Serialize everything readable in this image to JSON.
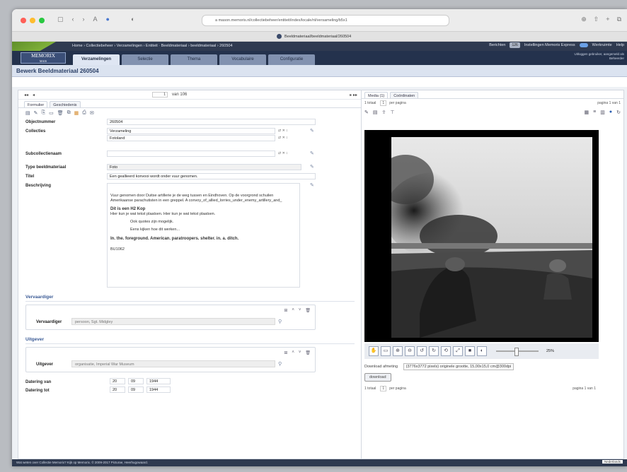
{
  "browser": {
    "url": "a mason.memoris.nl/collectiebeheer/entiteit/index/locale/nl/versameling/b5x1",
    "tab_title": "Beeldmateriaal/beeldmateriaal/260504",
    "colors": {
      "close": "#ff5f57",
      "min": "#febc2e",
      "max": "#28c840"
    }
  },
  "topnav": {
    "breadcrumb": "Home › Collectiebeheer › Verzamelingen › Entiteit · Beeldmateriaal › beeldmateriaal › 260504",
    "berichten_label": "Berichten",
    "berichten_count": "126",
    "instellingen": "Instellingen Memoris Express",
    "werkruimte": "Werkruimte",
    "help": "Help"
  },
  "menubar": {
    "logo": "MEMORIX",
    "logo_sub": "MAIS",
    "tabs": [
      "Verzamelingen",
      "Selectie",
      "Thema",
      "Vocabulaire",
      "Configuratie"
    ],
    "userinfo_1": "Uitloggen gebruiker, aangemeld als",
    "userinfo_2": "Beheerder"
  },
  "page": {
    "title": "Bewerk Beeldmateriaal 260504"
  },
  "pager": {
    "current": "1",
    "total_label": "van 106"
  },
  "subtabs": [
    "Formulier",
    "Geschiedenis"
  ],
  "form": {
    "objectnummer_label": "Objectnummer",
    "objectnummer": "260504",
    "collecties_label": "Collecties",
    "collecties": [
      "Verzameling",
      "Fotoland"
    ],
    "subcollectienaam_label": "Subcollectienaam",
    "subcollectienaam": "",
    "type_label": "Type beeldmateriaal",
    "type_value": "Foto",
    "titel_label": "Titel",
    "titel": "Een geallieerd konvooi wordt onder vuur genomen.",
    "beschrijving_label": "Beschrijving",
    "desc_p1": "Vuur genomen door Duitse artillerie je de weg tussen en Eindhoven. Op de voorgrond schuilen Amerikaanse parachutisten in een greppel. A convoy_of_allied_lorries_under_enemy_artillery_and_",
    "desc_h": "Dit is een H2 Kop",
    "desc_p2": "Hier kun je wat tekst plaatsen. Hier kun je wat tekst plaatsen.",
    "desc_q1": "Ook quotes zijn mogelijk.",
    "desc_q2": "Eens kijken hoe dit werken...",
    "desc_bold": "In. the. foreground. American. paratroopers. shelter. in. a. ditch.",
    "desc_end": "BU1062",
    "vervaardiger_section": "Vervaardiger",
    "vervaardiger_label": "Vervaardiger",
    "vervaardiger_value": "persoon, Sgt. Midgley",
    "uitgever_section": "Uitgever",
    "uitgever_label": "Uitgever",
    "uitgever_value": "organisatie, Imperial War Museum",
    "datering_van_label": "Datering van",
    "datering_van": [
      "20",
      "09",
      "1944"
    ],
    "datering_tot_label": "Datering tot",
    "datering_tot": [
      "20",
      "09",
      "1944"
    ]
  },
  "media": {
    "tabs": [
      "Media (1)",
      "Coördinaten"
    ],
    "count_label": "1 totaal",
    "per_page": "1",
    "per_page_label": "per pagina",
    "page_label": "pagina",
    "page_current": "1",
    "page_total": "van 1",
    "zoom": "25%",
    "download_label": "Download afmeting",
    "download_option": "(3776x3772 pixels) originele grootte, 15,00x15,0 cm@300dpi",
    "download_button": "download"
  },
  "footer": {
    "text": "Wat weten over Collectie Memorix? Kijk op Memorix. © 2009-2017 Picturae, Heerhugowaard.",
    "lang": "Nederlands"
  }
}
